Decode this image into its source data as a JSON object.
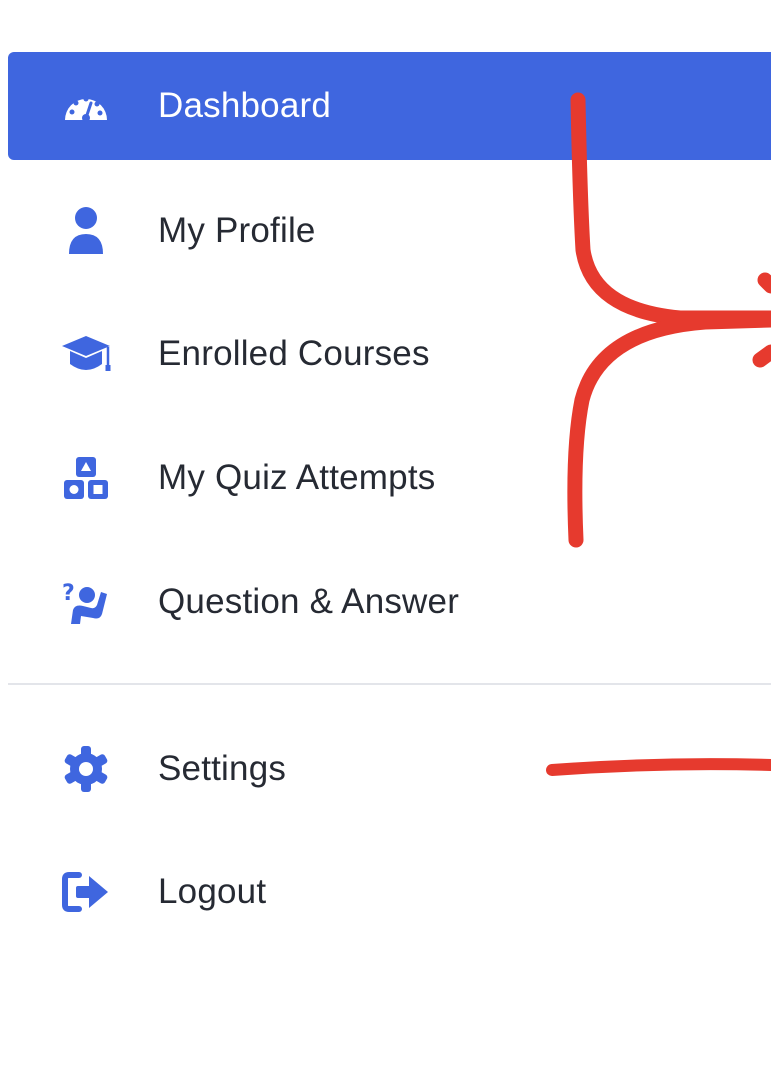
{
  "nav": {
    "items": [
      {
        "label": "Dashboard",
        "icon": "dashboard-icon",
        "active": true
      },
      {
        "label": "My Profile",
        "icon": "user-icon"
      },
      {
        "label": "Enrolled Courses",
        "icon": "graduation-cap-icon"
      },
      {
        "label": "My Quiz Attempts",
        "icon": "quiz-shapes-icon"
      },
      {
        "label": "Question & Answer",
        "icon": "question-person-icon"
      },
      {
        "label": "Settings",
        "icon": "gear-icon"
      },
      {
        "label": "Logout",
        "icon": "logout-icon"
      }
    ]
  },
  "colors": {
    "accent": "#3f66df",
    "icon": "#3f66df",
    "text": "#262a33",
    "annotation": "#e63a2e",
    "divider": "#e3e5ea"
  }
}
